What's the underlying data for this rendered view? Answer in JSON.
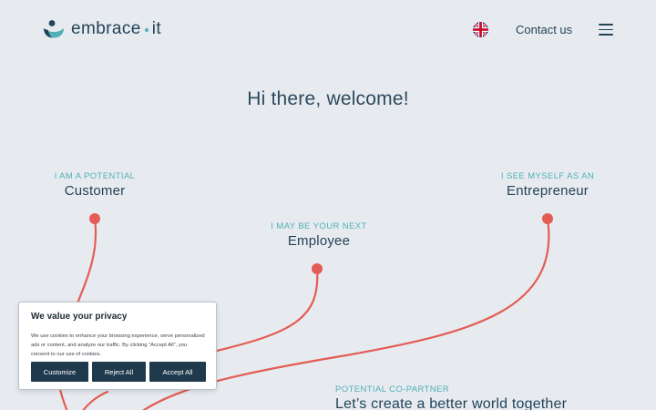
{
  "header": {
    "logo_text_left": "embrace",
    "logo_text_right": "it",
    "logo_icon": "embrace-logo-icon",
    "language_icon": "uk-flag-icon",
    "contact_label": "Contact us",
    "menu_icon": "hamburger-menu-icon"
  },
  "hero": {
    "welcome": "Hi there, welcome!"
  },
  "personas": {
    "customer": {
      "kicker": "I AM A POTENTIAL",
      "title": "Customer"
    },
    "employee": {
      "kicker": "I MAY BE YOUR NEXT",
      "title": "Employee"
    },
    "entrepreneur": {
      "kicker": "I SEE MYSELF AS AN",
      "title": "Entrepreneur"
    },
    "copartner": {
      "kicker": "POTENTIAL CO-PARTNER",
      "title": "Let’s create a better world together"
    }
  },
  "cookie_banner": {
    "title": "We value your privacy",
    "text": "We use cookies to enhance your browsing experience, serve personalized ads or content, and analyze our traffic. By clicking \"Accept All\", you consent to our use of cookies.",
    "customize_label": "Customize",
    "reject_label": "Reject All",
    "accept_label": "Accept All"
  },
  "colors": {
    "background": "#e7ebef",
    "text_primary": "#23435a",
    "accent_teal": "#4fb0b8",
    "path_red": "#e35d56",
    "button_dark": "#1f3a4d"
  }
}
